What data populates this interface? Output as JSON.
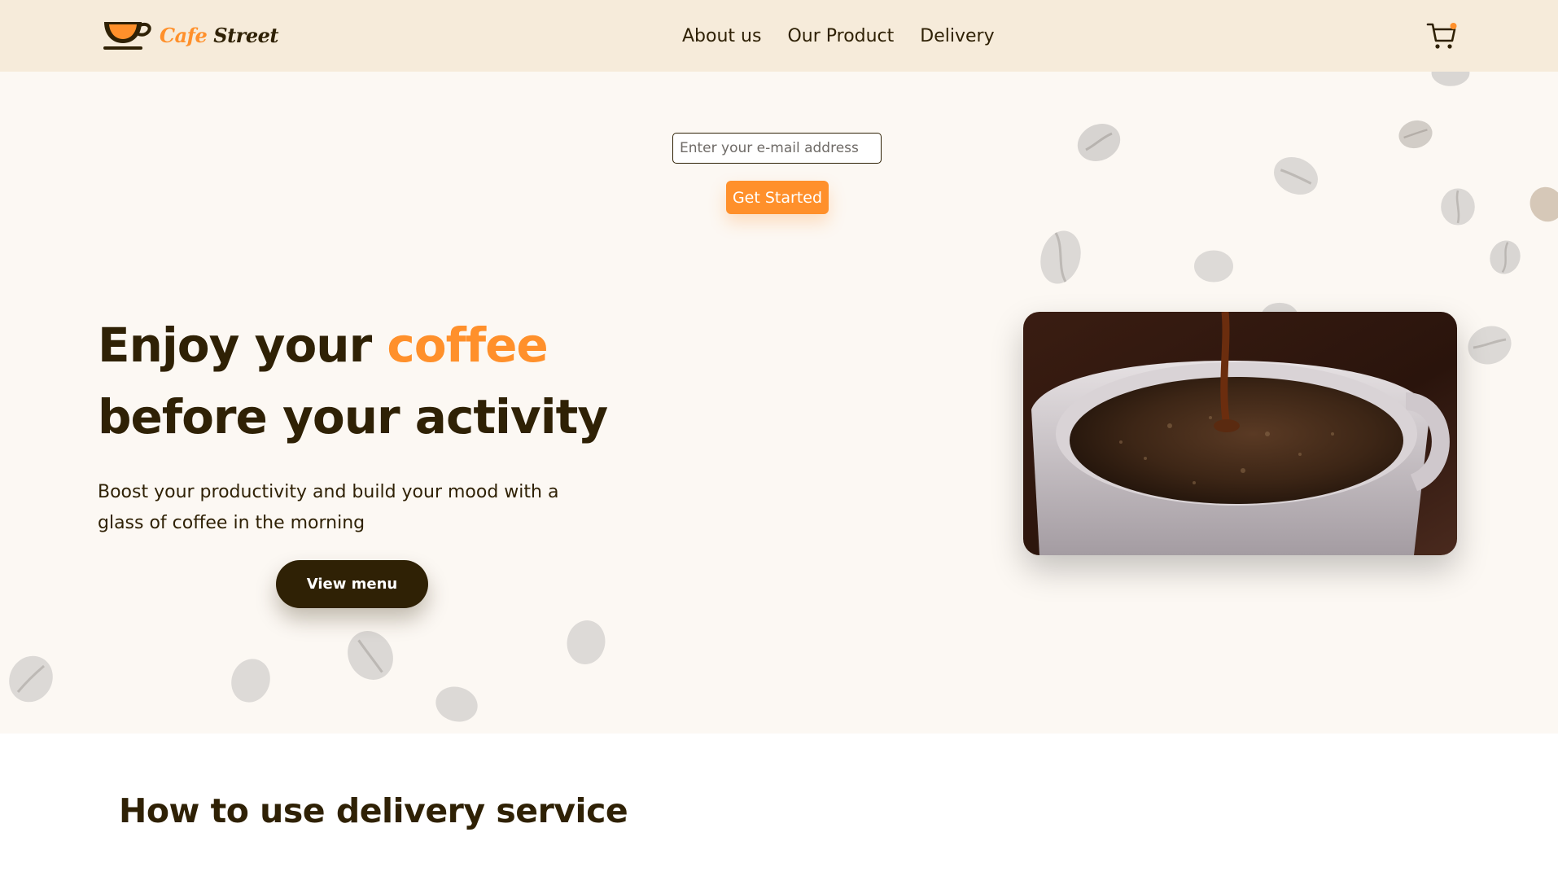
{
  "brand": {
    "logo_word_1": "Cafe",
    "logo_word_2": "Street",
    "colors": {
      "accent": "#ff902b",
      "dark": "#2f2105",
      "nav_bg": "#f6ebda",
      "hero_bg": "#fcf8f3"
    }
  },
  "nav": {
    "links": [
      "About us",
      "Our Product",
      "Delivery"
    ],
    "cart_icon": "shopping-cart-icon",
    "cart_badge_color": "#ff902b"
  },
  "signup": {
    "email_placeholder": "Enter your e-mail address",
    "button_label": "Get Started"
  },
  "hero": {
    "title_line1_before": "Enjoy your ",
    "title_line1_accent": "coffee",
    "title_line2": "before your activity",
    "subtitle": "Boost your productivity and build your mood with a glass of coffee in the morning",
    "cta_label": "View menu",
    "image_subject": "coffee being poured into a white cup"
  },
  "delivery_section": {
    "title": "How to use delivery service"
  }
}
